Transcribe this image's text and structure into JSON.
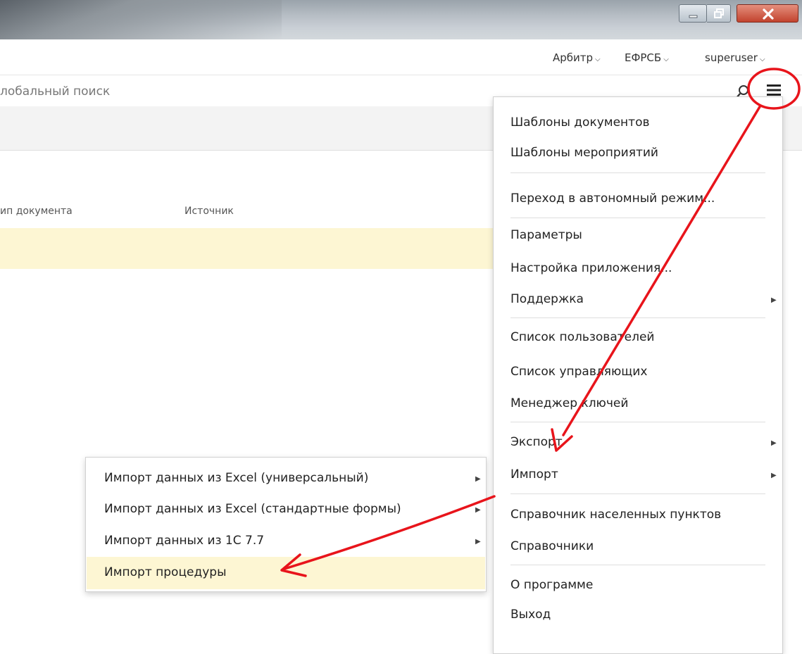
{
  "window": {
    "controls": [
      "minimize",
      "maximize",
      "close"
    ]
  },
  "userbar": {
    "arbitr": "Арбитр",
    "efrsb": "ЕФРСБ",
    "user": "superuser"
  },
  "search": {
    "placeholder": "лобальный поиск"
  },
  "table": {
    "columns": [
      "ип документа",
      "Источник"
    ]
  },
  "menu": {
    "items": [
      {
        "label": "Шаблоны документов"
      },
      {
        "label": "Шаблоны мероприятий"
      },
      {
        "label": "Переход в автономный режим..."
      },
      {
        "label": "Параметры"
      },
      {
        "label": "Настройка приложения..."
      },
      {
        "label": "Поддержка",
        "submenu": true
      },
      {
        "label": "Список пользователей"
      },
      {
        "label": "Список управляющих"
      },
      {
        "label": "Менеджер ключей"
      },
      {
        "label": "Экспорт",
        "submenu": true
      },
      {
        "label": "Импорт",
        "submenu": true
      },
      {
        "label": "Справочник населенных пунктов"
      },
      {
        "label": "Справочники"
      },
      {
        "label": "О программе"
      },
      {
        "label": "Выход"
      }
    ]
  },
  "import_submenu": {
    "items": [
      {
        "label": "Импорт данных из Excel (универсальный)",
        "submenu": true
      },
      {
        "label": "Импорт данных из Excel (стандартные формы)",
        "submenu": true
      },
      {
        "label": "Импорт данных из 1С 7.7",
        "submenu": true
      },
      {
        "label": "Импорт процедуры",
        "highlighted": true
      }
    ]
  },
  "colors": {
    "highlight": "#fdf6d3",
    "annotation": "#e8141b",
    "close_button": "#c2432e"
  },
  "icons": {
    "search": "search-icon",
    "menu": "hamburger-icon",
    "submenu_arrow": "triangle-right-icon",
    "caret": "chevron-down-icon"
  }
}
